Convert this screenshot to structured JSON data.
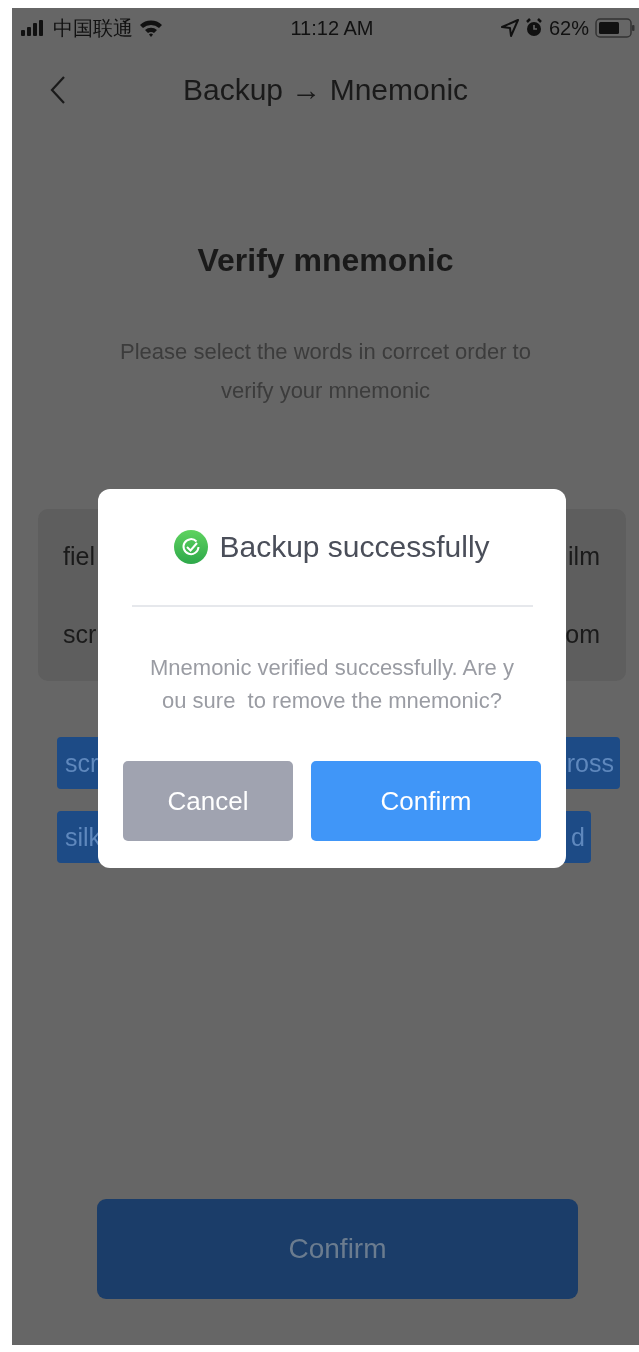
{
  "status_bar": {
    "carrier": "中国联通",
    "time": "11:12 AM",
    "battery": "62%"
  },
  "nav": {
    "title": "Backup → Mnemonic"
  },
  "heading": "Verify mnemonic",
  "description": "Please select the words in corrcet order to verify your mnemonic",
  "word_rows": [
    {
      "left": "fiel",
      "right": "ilm"
    },
    {
      "left": "scr",
      "right": "om"
    }
  ],
  "word_chips": [
    {
      "left": "scr",
      "right": "ross"
    },
    {
      "left": "silk",
      "right": "d"
    }
  ],
  "dialog": {
    "title": "Backup successfully",
    "message": "Mnemonic verified successfully. Are you sure  to remove the mnemonic?",
    "buttons": [
      {
        "label": "Cancel",
        "kind": "secondary"
      },
      {
        "label": "Confirm",
        "kind": "primary"
      }
    ]
  },
  "confirm_button": {
    "label": "Confirm"
  }
}
